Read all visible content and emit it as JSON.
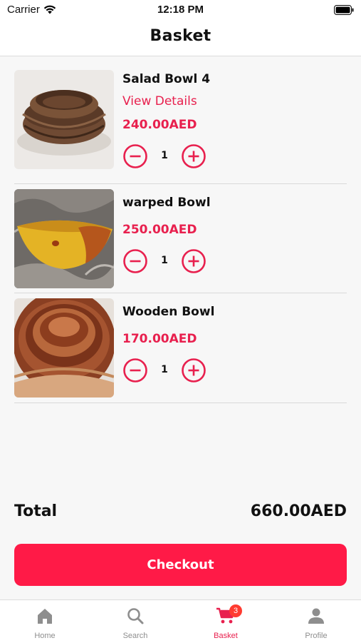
{
  "status_bar": {
    "carrier": "Carrier",
    "time": "12:18 PM"
  },
  "nav": {
    "title": "Basket"
  },
  "basket": {
    "items": [
      {
        "name": "Salad Bowl 4",
        "details_link": "View Details",
        "price": "240.00AED",
        "quantity": "1"
      },
      {
        "name": "warped Bowl",
        "price": "250.00AED",
        "quantity": "1"
      },
      {
        "name": "Wooden Bowl",
        "price": "170.00AED",
        "quantity": "1"
      }
    ]
  },
  "summary": {
    "total_label": "Total",
    "total_amount": "660.00AED"
  },
  "checkout": {
    "label": "Checkout"
  },
  "tab_bar": {
    "tabs": [
      {
        "label": "Home",
        "icon": "home-icon"
      },
      {
        "label": "Search",
        "icon": "search-icon"
      },
      {
        "label": "Basket",
        "icon": "cart-icon",
        "badge": "3"
      },
      {
        "label": "Profile",
        "icon": "person-icon"
      }
    ],
    "active_tab": "Basket"
  },
  "colors": {
    "accent": "#ff1a47",
    "accent_text": "#e8204e",
    "tab_inactive": "#8e8e8e"
  }
}
